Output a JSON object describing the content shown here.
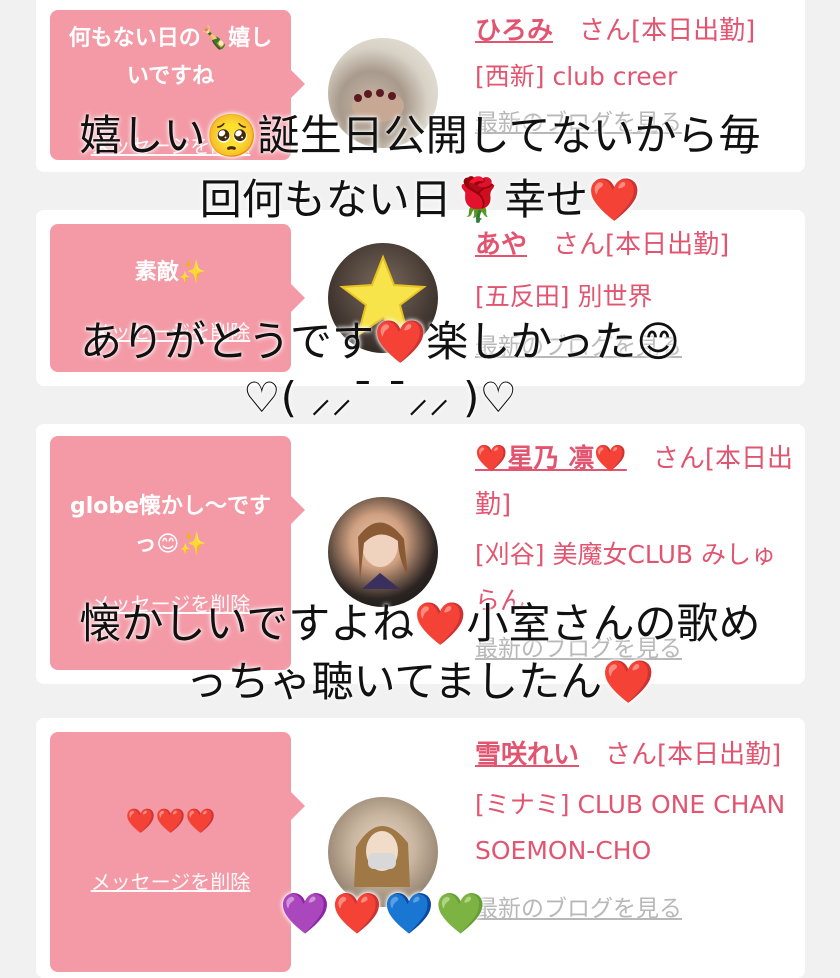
{
  "cards": [
    {
      "message": "何もない日の🍾嬉しいですね",
      "delete_label": "メッセージを削除",
      "girl_name": "ひろみ",
      "status": "さん[本日出勤]",
      "shop": "[西新] club creer",
      "blog_link": "最新のブログを見る"
    },
    {
      "message": "素敵✨",
      "delete_label": "メッセージを削除",
      "girl_name": "あや",
      "status": "さん[本日出勤]",
      "shop": "[五反田] 別世界",
      "blog_link": "最新のブログを見る"
    },
    {
      "message": "globe懐かし〜ですっ😊✨",
      "delete_label": "メッセージを削除",
      "girl_name": "❤️星乃 凛❤️",
      "status": "さん[本日出勤]",
      "shop": "[刈谷] 美魔女CLUB みしゅらん",
      "blog_link": "最新のブログを見る"
    },
    {
      "message": "❤️❤️❤️",
      "delete_label": "メッセージを削除",
      "girl_name": "雪咲れい",
      "status": "さん[本日出勤]",
      "shop": "[ミナミ] CLUB ONE CHAN SOEMON-CHO",
      "blog_link": "最新のブログを見る"
    }
  ],
  "overlays": [
    "嬉しい🥺誕生日公開してないから毎",
    "回何もない日🌹幸せ❤️",
    "ありがとうです❤️楽しかった😊",
    "♡( ⸝⸝¯ ¯⸝⸝ )♡",
    "懐かしいですよね❤️小室さんの歌め",
    "っちゃ聴いてましたん❤️",
    "💜❤️💙💚"
  ],
  "colors": {
    "bubble": "#f39aa6",
    "name_pink": "#e25571",
    "background": "#f1f1f1"
  }
}
